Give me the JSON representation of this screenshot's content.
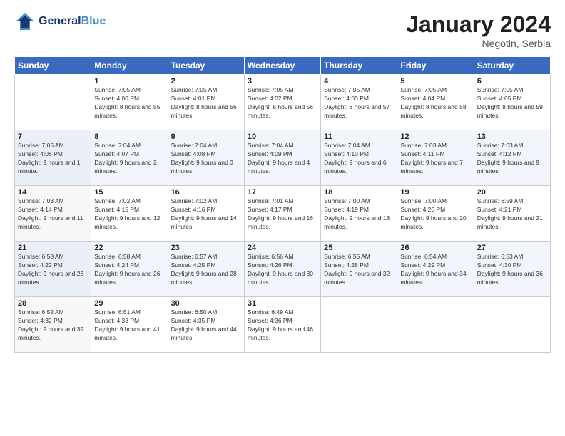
{
  "header": {
    "logo_line1": "General",
    "logo_line2": "Blue",
    "title": "January 2024",
    "subtitle": "Negotin, Serbia"
  },
  "days_of_week": [
    "Sunday",
    "Monday",
    "Tuesday",
    "Wednesday",
    "Thursday",
    "Friday",
    "Saturday"
  ],
  "weeks": [
    [
      {
        "day": "",
        "sunrise": "",
        "sunset": "",
        "daylight": ""
      },
      {
        "day": "1",
        "sunrise": "Sunrise: 7:05 AM",
        "sunset": "Sunset: 4:00 PM",
        "daylight": "Daylight: 8 hours and 55 minutes."
      },
      {
        "day": "2",
        "sunrise": "Sunrise: 7:05 AM",
        "sunset": "Sunset: 4:01 PM",
        "daylight": "Daylight: 8 hours and 56 minutes."
      },
      {
        "day": "3",
        "sunrise": "Sunrise: 7:05 AM",
        "sunset": "Sunset: 4:02 PM",
        "daylight": "Daylight: 8 hours and 56 minutes."
      },
      {
        "day": "4",
        "sunrise": "Sunrise: 7:05 AM",
        "sunset": "Sunset: 4:03 PM",
        "daylight": "Daylight: 8 hours and 57 minutes."
      },
      {
        "day": "5",
        "sunrise": "Sunrise: 7:05 AM",
        "sunset": "Sunset: 4:04 PM",
        "daylight": "Daylight: 8 hours and 58 minutes."
      },
      {
        "day": "6",
        "sunrise": "Sunrise: 7:05 AM",
        "sunset": "Sunset: 4:05 PM",
        "daylight": "Daylight: 8 hours and 59 minutes."
      }
    ],
    [
      {
        "day": "7",
        "sunrise": "Sunrise: 7:05 AM",
        "sunset": "Sunset: 4:06 PM",
        "daylight": "Daylight: 9 hours and 1 minute."
      },
      {
        "day": "8",
        "sunrise": "Sunrise: 7:04 AM",
        "sunset": "Sunset: 4:07 PM",
        "daylight": "Daylight: 9 hours and 2 minutes."
      },
      {
        "day": "9",
        "sunrise": "Sunrise: 7:04 AM",
        "sunset": "Sunset: 4:08 PM",
        "daylight": "Daylight: 9 hours and 3 minutes."
      },
      {
        "day": "10",
        "sunrise": "Sunrise: 7:04 AM",
        "sunset": "Sunset: 4:09 PM",
        "daylight": "Daylight: 9 hours and 4 minutes."
      },
      {
        "day": "11",
        "sunrise": "Sunrise: 7:04 AM",
        "sunset": "Sunset: 4:10 PM",
        "daylight": "Daylight: 9 hours and 6 minutes."
      },
      {
        "day": "12",
        "sunrise": "Sunrise: 7:03 AM",
        "sunset": "Sunset: 4:11 PM",
        "daylight": "Daylight: 9 hours and 7 minutes."
      },
      {
        "day": "13",
        "sunrise": "Sunrise: 7:03 AM",
        "sunset": "Sunset: 4:12 PM",
        "daylight": "Daylight: 9 hours and 9 minutes."
      }
    ],
    [
      {
        "day": "14",
        "sunrise": "Sunrise: 7:03 AM",
        "sunset": "Sunset: 4:14 PM",
        "daylight": "Daylight: 9 hours and 11 minutes."
      },
      {
        "day": "15",
        "sunrise": "Sunrise: 7:02 AM",
        "sunset": "Sunset: 4:15 PM",
        "daylight": "Daylight: 9 hours and 12 minutes."
      },
      {
        "day": "16",
        "sunrise": "Sunrise: 7:02 AM",
        "sunset": "Sunset: 4:16 PM",
        "daylight": "Daylight: 9 hours and 14 minutes."
      },
      {
        "day": "17",
        "sunrise": "Sunrise: 7:01 AM",
        "sunset": "Sunset: 4:17 PM",
        "daylight": "Daylight: 9 hours and 16 minutes."
      },
      {
        "day": "18",
        "sunrise": "Sunrise: 7:00 AM",
        "sunset": "Sunset: 4:19 PM",
        "daylight": "Daylight: 9 hours and 18 minutes."
      },
      {
        "day": "19",
        "sunrise": "Sunrise: 7:00 AM",
        "sunset": "Sunset: 4:20 PM",
        "daylight": "Daylight: 9 hours and 20 minutes."
      },
      {
        "day": "20",
        "sunrise": "Sunrise: 6:59 AM",
        "sunset": "Sunset: 4:21 PM",
        "daylight": "Daylight: 9 hours and 21 minutes."
      }
    ],
    [
      {
        "day": "21",
        "sunrise": "Sunrise: 6:58 AM",
        "sunset": "Sunset: 4:22 PM",
        "daylight": "Daylight: 9 hours and 23 minutes."
      },
      {
        "day": "22",
        "sunrise": "Sunrise: 6:58 AM",
        "sunset": "Sunset: 4:24 PM",
        "daylight": "Daylight: 9 hours and 26 minutes."
      },
      {
        "day": "23",
        "sunrise": "Sunrise: 6:57 AM",
        "sunset": "Sunset: 4:25 PM",
        "daylight": "Daylight: 9 hours and 28 minutes."
      },
      {
        "day": "24",
        "sunrise": "Sunrise: 6:56 AM",
        "sunset": "Sunset: 4:26 PM",
        "daylight": "Daylight: 9 hours and 30 minutes."
      },
      {
        "day": "25",
        "sunrise": "Sunrise: 6:55 AM",
        "sunset": "Sunset: 4:28 PM",
        "daylight": "Daylight: 9 hours and 32 minutes."
      },
      {
        "day": "26",
        "sunrise": "Sunrise: 6:54 AM",
        "sunset": "Sunset: 4:29 PM",
        "daylight": "Daylight: 9 hours and 34 minutes."
      },
      {
        "day": "27",
        "sunrise": "Sunrise: 6:53 AM",
        "sunset": "Sunset: 4:30 PM",
        "daylight": "Daylight: 9 hours and 36 minutes."
      }
    ],
    [
      {
        "day": "28",
        "sunrise": "Sunrise: 6:52 AM",
        "sunset": "Sunset: 4:32 PM",
        "daylight": "Daylight: 9 hours and 39 minutes."
      },
      {
        "day": "29",
        "sunrise": "Sunrise: 6:51 AM",
        "sunset": "Sunset: 4:33 PM",
        "daylight": "Daylight: 9 hours and 41 minutes."
      },
      {
        "day": "30",
        "sunrise": "Sunrise: 6:50 AM",
        "sunset": "Sunset: 4:35 PM",
        "daylight": "Daylight: 9 hours and 44 minutes."
      },
      {
        "day": "31",
        "sunrise": "Sunrise: 6:49 AM",
        "sunset": "Sunset: 4:36 PM",
        "daylight": "Daylight: 9 hours and 46 minutes."
      },
      {
        "day": "",
        "sunrise": "",
        "sunset": "",
        "daylight": ""
      },
      {
        "day": "",
        "sunrise": "",
        "sunset": "",
        "daylight": ""
      },
      {
        "day": "",
        "sunrise": "",
        "sunset": "",
        "daylight": ""
      }
    ]
  ]
}
